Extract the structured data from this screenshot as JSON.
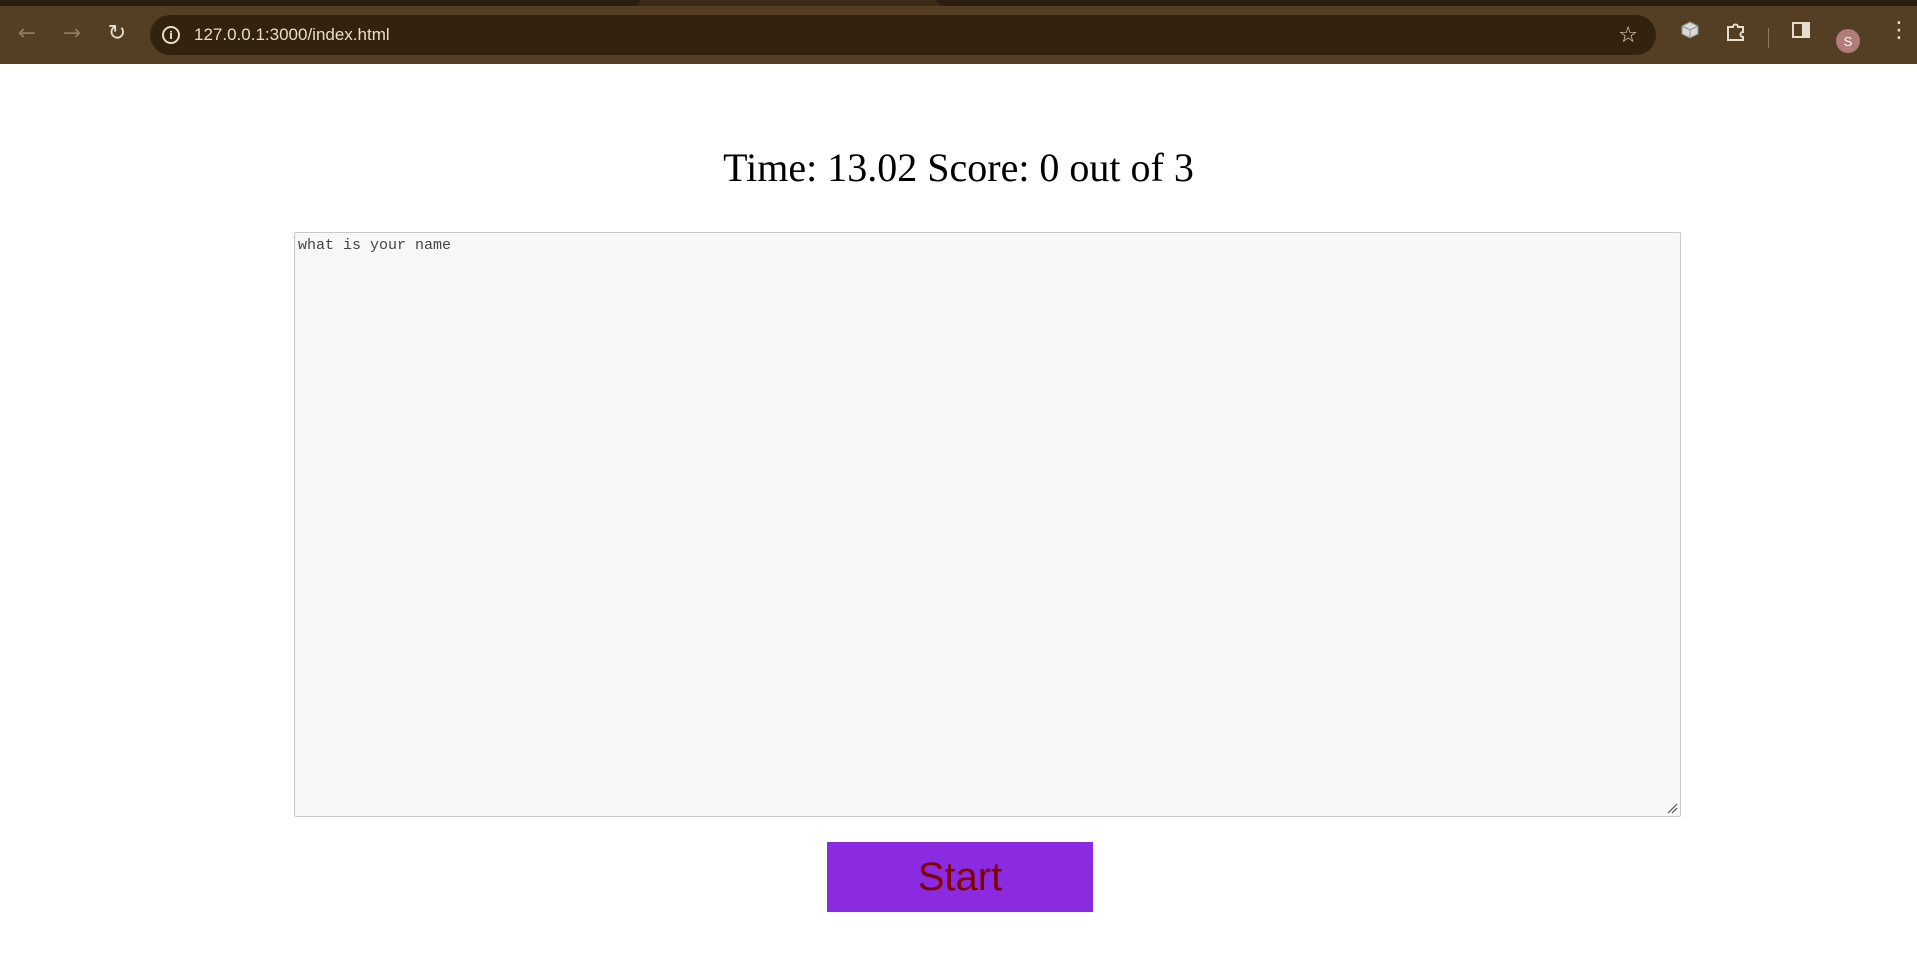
{
  "browser": {
    "url": "127.0.0.1:3000/index.html",
    "profile_initial": "S",
    "icons": {
      "back": "arrow-left-icon",
      "forward": "arrow-right-icon",
      "reload": "reload-icon",
      "info": "info-icon",
      "bookmark": "star-icon",
      "extension_cube": "cube-icon",
      "extensions": "puzzle-icon",
      "side_panel": "side-panel-icon",
      "menu": "kebab-menu-icon"
    },
    "colors": {
      "toolbar": "#553f24",
      "address_bar": "#33220f"
    }
  },
  "game": {
    "status_text": "Time: 13.02 Score: 0 out of 3",
    "answer_field": {
      "value": "",
      "placeholder": "what is your name"
    },
    "start_label": "Start",
    "colors": {
      "button_bg": "#8a2be2",
      "button_text": "#800000"
    }
  }
}
